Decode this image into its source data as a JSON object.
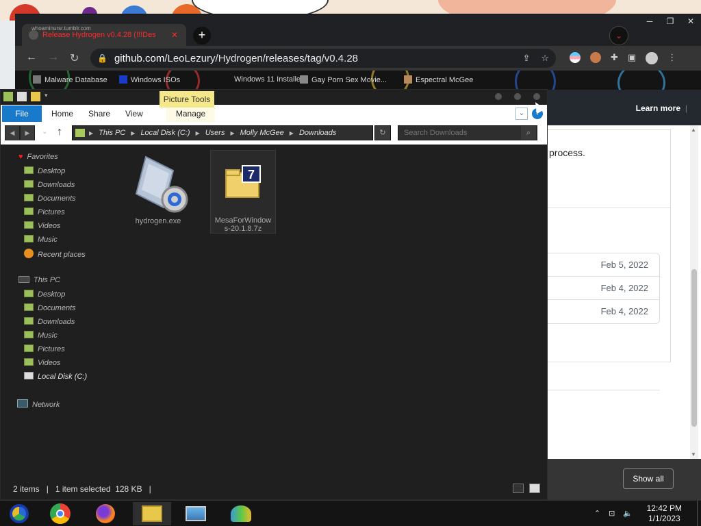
{
  "browser": {
    "tab_title": "Release Hydrogen v0.4.28 (!!!Des",
    "tab_overlay": "whoaminursr.tumblr.com",
    "new_tab_label": "+",
    "url_host": "github.com",
    "url_path": "/LeoLezury/Hydrogen/releases/tag/v0.4.28",
    "bookmarks": [
      {
        "label": "Malware Database"
      },
      {
        "label": "Windows ISOs"
      },
      {
        "label": "Windows 11 Installer"
      },
      {
        "label": "Gay Porn Sex Movie..."
      },
      {
        "label": "Espectral McGee"
      }
    ],
    "window_controls": [
      "─",
      "❐",
      "✕"
    ]
  },
  "github": {
    "learn_more": "Learn more",
    "body_fragment": "process.",
    "asset_dates": [
      "Feb 5, 2022",
      "Feb 4, 2022",
      "Feb 4, 2022"
    ],
    "show_all": "Show all"
  },
  "explorer": {
    "contextual_tab": "Picture Tools",
    "ribbon": {
      "file": "File",
      "home": "Home",
      "share": "Share",
      "view": "View",
      "manage": "Manage"
    },
    "breadcrumb": [
      "This PC",
      "Local Disk (C:)",
      "Users",
      "Molly McGee",
      "Downloads"
    ],
    "search_placeholder": "Search Downloads",
    "nav": {
      "favorites": "Favorites",
      "fav_desktop": "Desktop",
      "fav_downloads": "Downloads",
      "fav_documents": "Documents",
      "fav_pictures": "Pictures",
      "fav_videos": "Videos",
      "fav_music": "Music",
      "fav_recent": "Recent places",
      "this_pc": "This PC",
      "pc_desktop": "Desktop",
      "pc_documents": "Documents",
      "pc_downloads": "Downloads",
      "pc_music": "Music",
      "pc_pictures": "Pictures",
      "pc_videos": "Videos",
      "pc_local_disk": "Local Disk (C:)",
      "network": "Network"
    },
    "files": [
      {
        "name": "hydrogen.exe",
        "selected": false
      },
      {
        "name": "MesaForWindows-20.1.8.7z",
        "selected": true
      }
    ],
    "status": {
      "items": "2 items",
      "selected": "1 item selected",
      "size": "128 KB"
    }
  },
  "taskbar": {
    "time": "12:42 PM",
    "date": "1/1/2023",
    "apps": [
      "chromium-icon",
      "chrome-icon",
      "firefox-icon",
      "file-explorer-icon",
      "photos-icon",
      "network-users-icon"
    ]
  }
}
